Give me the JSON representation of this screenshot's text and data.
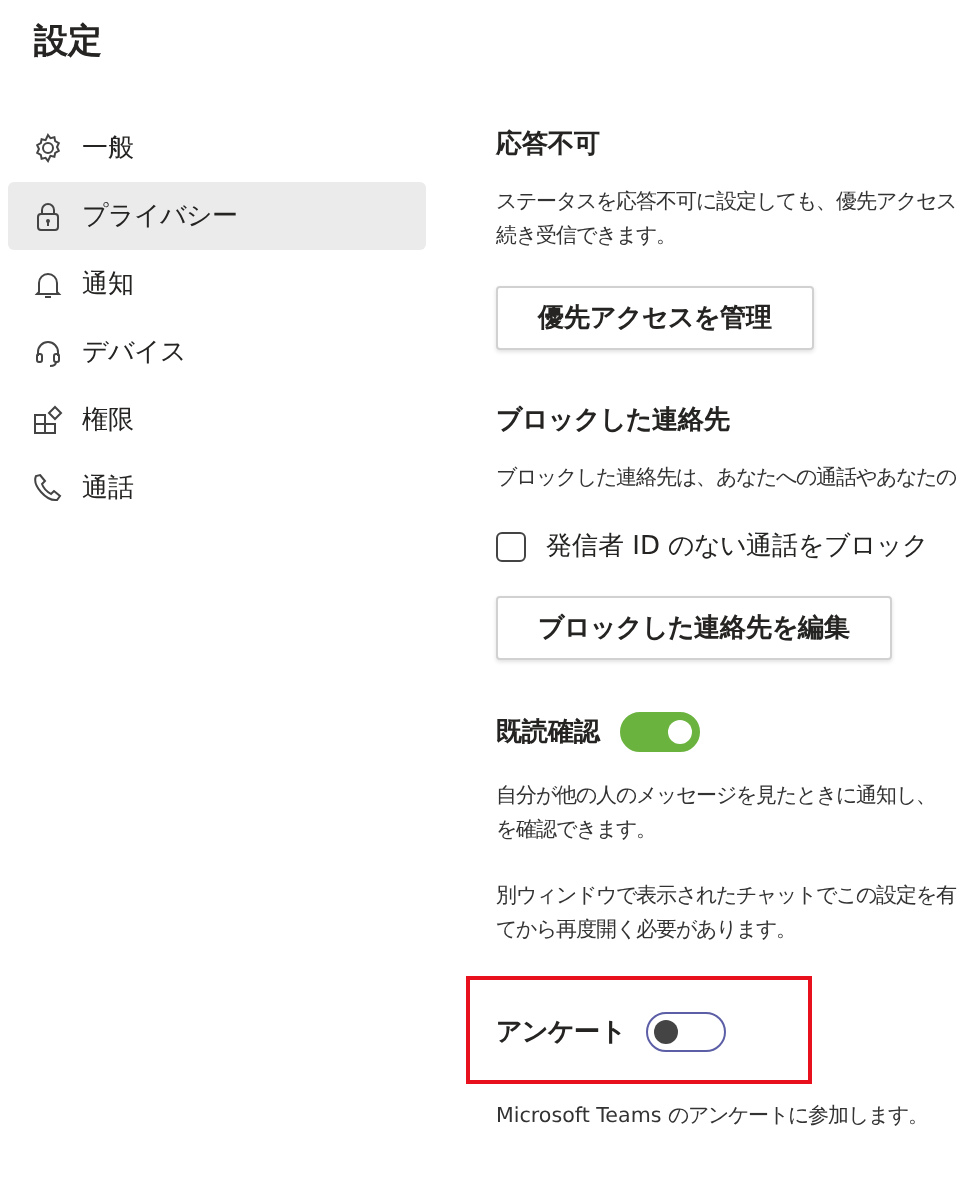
{
  "title": "設定",
  "sidebar": {
    "items": [
      {
        "label": "一般",
        "selected": false
      },
      {
        "label": "プライバシー",
        "selected": true
      },
      {
        "label": "通知",
        "selected": false
      },
      {
        "label": "デバイス",
        "selected": false
      },
      {
        "label": "権限",
        "selected": false
      },
      {
        "label": "通話",
        "selected": false
      }
    ]
  },
  "content": [
    {
      "kind": "heading",
      "text": "応答不可"
    },
    {
      "kind": "text",
      "lines": [
        "ステータスを応答不可に設定しても、優先アクセス",
        "続き受信できます。"
      ]
    },
    {
      "kind": "button",
      "label": "優先アクセスを管理"
    },
    {
      "kind": "heading",
      "text": "ブロックした連絡先"
    },
    {
      "kind": "text",
      "lines": [
        "ブロックした連絡先は、あなたへの通話やあなたの"
      ]
    },
    {
      "kind": "checkbox",
      "label": "発信者 ID のない通話をブロック",
      "checked": false
    },
    {
      "kind": "button",
      "label": "ブロックした連絡先を編集"
    },
    {
      "kind": "toggle",
      "label": "既読確認",
      "on": true,
      "highlighted": false
    },
    {
      "kind": "text",
      "lines": [
        "自分が他の人のメッセージを見たときに通知し、",
        "を確認できます。"
      ]
    },
    {
      "kind": "text",
      "lines": [
        "別ウィンドウで表示されたチャットでこの設定を有",
        "てから再度開く必要があります。"
      ]
    },
    {
      "kind": "toggle",
      "label": "アンケート",
      "on": false,
      "highlighted": true
    },
    {
      "kind": "text",
      "lines": [
        "Microsoft Teams のアンケートに参加します。"
      ]
    }
  ]
}
